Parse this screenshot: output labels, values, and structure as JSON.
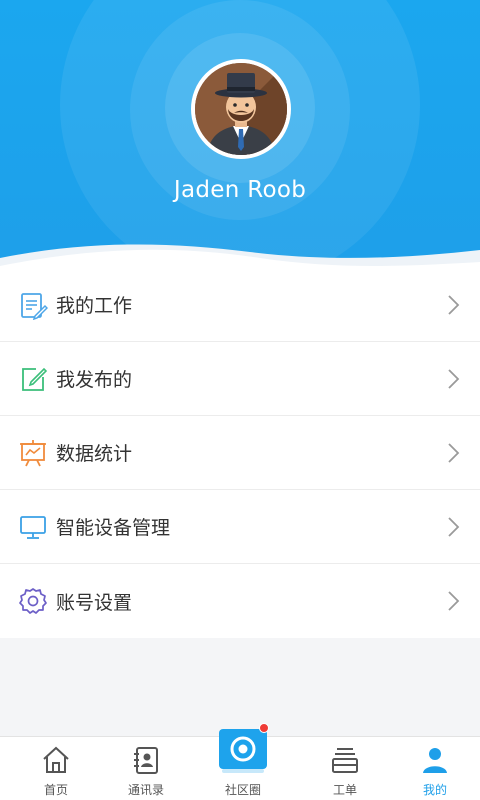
{
  "profile": {
    "name": "Jaden Roob",
    "avatar_icon": "person-top-hat-avatar"
  },
  "menu": [
    {
      "label": "我的工作",
      "icon": "document-edit-icon",
      "color": "#4da6e8"
    },
    {
      "label": "我发布的",
      "icon": "edit-square-icon",
      "color": "#3bbf7a"
    },
    {
      "label": "数据统计",
      "icon": "presentation-chart-icon",
      "color": "#f08b3c"
    },
    {
      "label": "智能设备管理",
      "icon": "monitor-icon",
      "color": "#3aa0e6"
    },
    {
      "label": "账号设置",
      "icon": "gear-icon",
      "color": "#6c5fc7"
    }
  ],
  "tabbar": {
    "items": [
      {
        "label": "首页",
        "icon": "home-icon"
      },
      {
        "label": "通讯录",
        "icon": "contacts-icon"
      },
      {
        "label": "社区圈",
        "icon": "community-icon",
        "badge": true
      },
      {
        "label": "工单",
        "icon": "work-order-icon"
      },
      {
        "label": "我的",
        "icon": "user-icon",
        "active": true
      }
    ]
  },
  "colors": {
    "header": "#1ba7ef",
    "active": "#1e9fe9",
    "badge": "#ef3b36"
  }
}
